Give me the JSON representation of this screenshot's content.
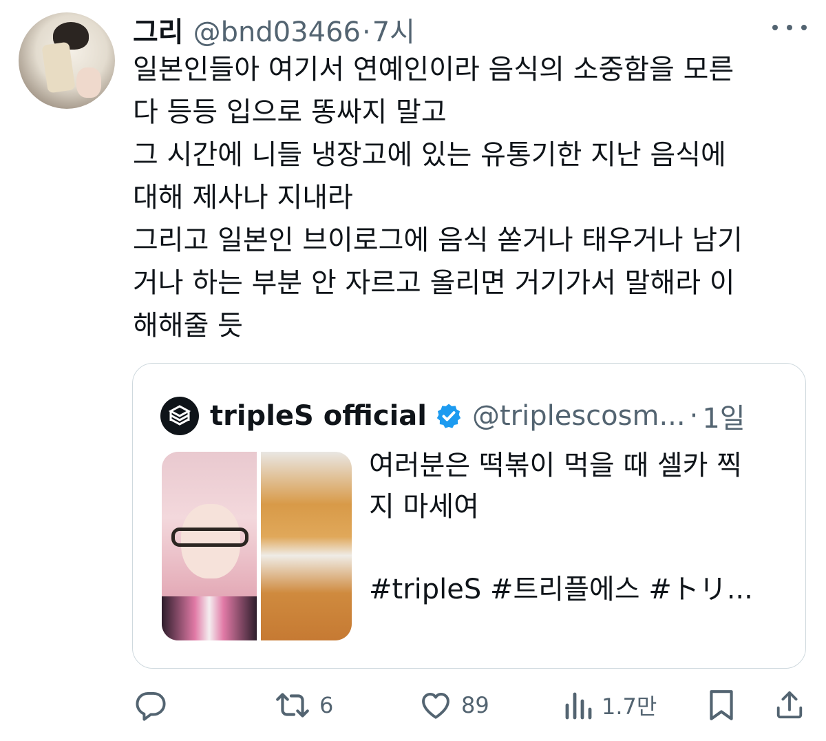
{
  "author": {
    "display_name": "그리",
    "handle": "@bnd03466",
    "separator": "·",
    "time": "7시"
  },
  "tweet": {
    "lines": [
      "일본인들아 여기서 연예인이라 음식의 소중함을 모른",
      "다 등등 입으로 똥싸지 말고",
      "그 시간에 니들 냉장고에 있는 유통기한 지난 음식에",
      "대해 제사나 지내라",
      "그리고 일본인 브이로그에 음식 쏟거나 태우거나 남기",
      "거나 하는 부분 안 자르고 올리면 거기가서 말해라 이",
      "해해줄 듯"
    ]
  },
  "quote": {
    "display_name": "tripleS official",
    "handle": "@triplescosm...",
    "separator": "·",
    "time": "1일",
    "lines": [
      "여러분은 떡볶이 먹을 때 셀카 찍",
      "지 마세여",
      "",
      "#tripleS #트리플에스 #トリ..."
    ]
  },
  "actions": {
    "reply": {
      "icon": "reply-icon",
      "count": ""
    },
    "retweet": {
      "icon": "retweet-icon",
      "count": "6"
    },
    "like": {
      "icon": "heart-icon",
      "count": "89"
    },
    "views": {
      "icon": "views-icon",
      "count": "1.7만"
    },
    "bookmark": {
      "icon": "bookmark-icon"
    },
    "share": {
      "icon": "share-icon"
    }
  },
  "colors": {
    "text": "#0f1419",
    "secondary": "#536471",
    "border": "#cfd9de",
    "verified": "#1d9bf0"
  }
}
